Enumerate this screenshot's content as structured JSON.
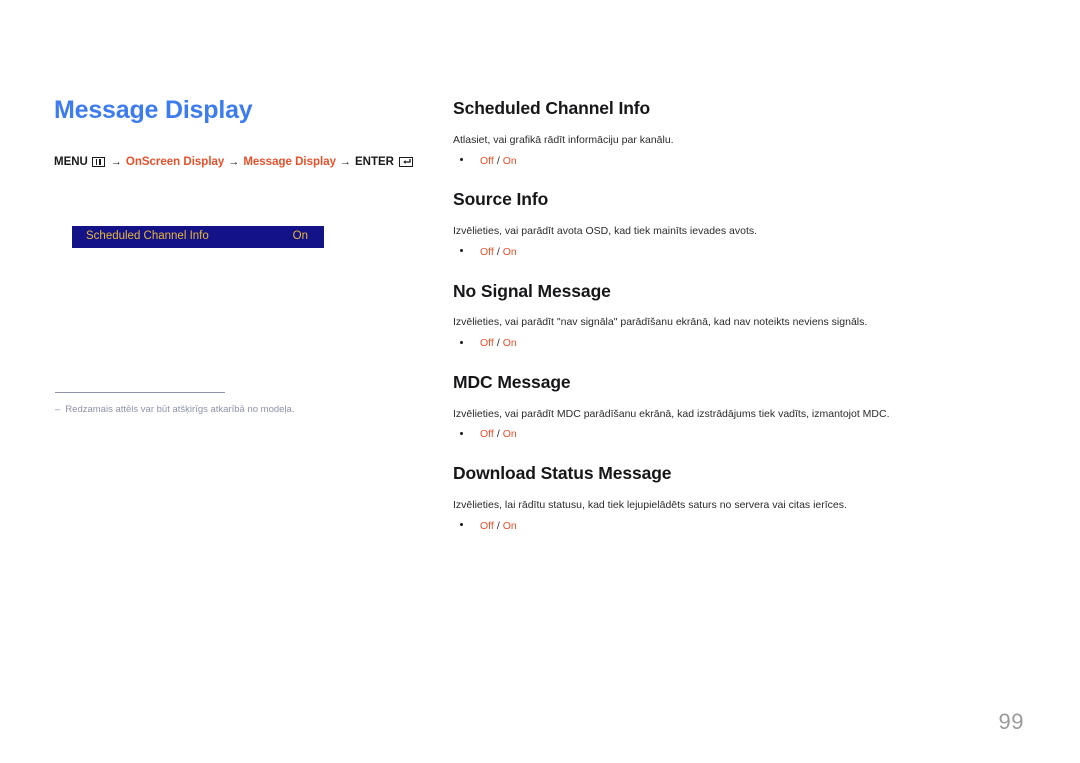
{
  "document": {
    "page_number": "99"
  },
  "left": {
    "title": "Message Display",
    "breadcrumb": {
      "menu_label": "MENU",
      "menu_icon": "menu-grid-icon",
      "arrow": "→",
      "step1": "OnScreen Display",
      "step2": "Message Display",
      "enter_label": "ENTER",
      "enter_icon": "enter-return-icon"
    },
    "osd": {
      "label": "Scheduled Channel Info",
      "value": "On",
      "background_color": "#131286",
      "text_color": "#e8b83a"
    },
    "footnote": {
      "dash": "–",
      "text": "Redzamais attēls var būt atšķirīgs atkarībā no modeļa."
    }
  },
  "right": {
    "sections": [
      {
        "title": "Scheduled Channel Info",
        "description": "Atlasiet, vai grafikā rādīt informāciju par kanālu.",
        "option_off": "Off",
        "option_sep": "/",
        "option_on": "On"
      },
      {
        "title": "Source Info",
        "description": "Izvēlieties, vai parādīt avota OSD, kad tiek mainīts ievades avots.",
        "option_off": "Off",
        "option_sep": "/",
        "option_on": "On"
      },
      {
        "title": "No Signal Message",
        "description": "Izvēlieties, vai parādīt \"nav signāla\" parādīšanu ekrānā, kad nav noteikts neviens signāls.",
        "option_off": "Off",
        "option_sep": "/",
        "option_on": "On"
      },
      {
        "title": "MDC Message",
        "description": "Izvēlieties, vai parādīt MDC parādīšanu ekrānā, kad izstrādājums tiek vadīts, izmantojot MDC.",
        "option_off": "Off",
        "option_sep": "/",
        "option_on": "On"
      },
      {
        "title": "Download Status Message",
        "description": "Izvēlieties, lai rādītu statusu, kad tiek lejupielādēts saturs no servera vai citas ierīces.",
        "option_off": "Off",
        "option_sep": "/",
        "option_on": "On"
      }
    ]
  },
  "colors": {
    "title_blue": "#3d7bf0",
    "link_orange": "#e8502a",
    "osd_navy": "#131286",
    "osd_gold": "#e8b83a",
    "footnote_gray": "#8e92ab",
    "page_number_gray": "#9a9a9a"
  }
}
